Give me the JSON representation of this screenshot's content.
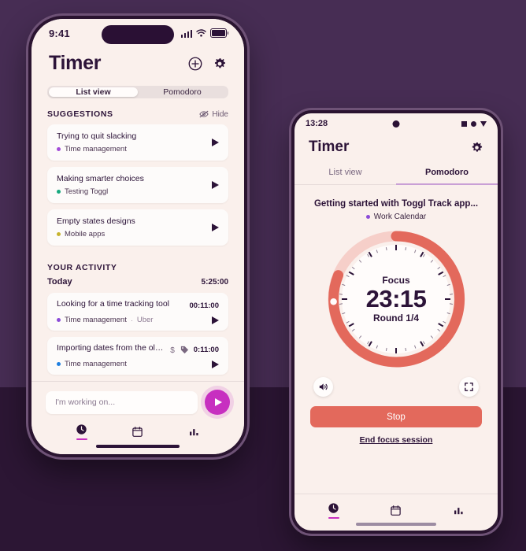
{
  "background": {
    "upper_color": "#472D54",
    "lower_color": "#2C1634"
  },
  "iphone": {
    "status_bar": {
      "time": "9:41",
      "signal_icon": "cellular-signal-icon",
      "wifi_icon": "wifi-icon",
      "battery_icon": "battery-icon"
    },
    "header": {
      "title": "Timer",
      "add_icon": "plus-circle-icon",
      "settings_icon": "gear-icon"
    },
    "segmented_control": {
      "options": [
        "List view",
        "Pomodoro"
      ],
      "selected": "List view"
    },
    "suggestions": {
      "section_title": "SUGGESTIONS",
      "hide_label": "Hide",
      "hide_icon": "eye-off-icon",
      "items": [
        {
          "title": "Trying to quit slacking",
          "project": "Time management",
          "dot_color": "#A34CD8",
          "play_icon": "play-icon"
        },
        {
          "title": "Making smarter choices",
          "project": "Testing Toggl",
          "dot_color": "#17A97F",
          "play_icon": "play-icon"
        },
        {
          "title": "Empty states designs",
          "project": "Mobile apps",
          "dot_color": "#C7B32E",
          "play_icon": "play-icon"
        }
      ]
    },
    "activity": {
      "section_title": "YOUR ACTIVITY",
      "day_label": "Today",
      "day_total": "5:25:00",
      "entries": [
        {
          "title": "Looking for a time tracking tool",
          "project": "Time management",
          "dot_color": "#8B4BD8",
          "client": "Uber",
          "separator": "·",
          "duration": "00:11:00",
          "play_icon": "play-icon",
          "badges": []
        },
        {
          "title": "Importing dates from the old...",
          "project": "Time management",
          "dot_color": "#1E7FE0",
          "client": "",
          "separator": "",
          "duration": "0:11:00",
          "play_icon": "play-icon",
          "badges": [
            "billable-dollar-icon",
            "tag-icon"
          ]
        }
      ]
    },
    "composer": {
      "placeholder": "I'm working on...",
      "start_icon": "play-icon",
      "start_color": "#C72FC0"
    },
    "nav": [
      {
        "icon": "clock-icon",
        "active": true
      },
      {
        "icon": "calendar-icon",
        "active": false
      },
      {
        "icon": "reports-bar-chart-icon",
        "active": false
      }
    ]
  },
  "android": {
    "status_bar": {
      "time": "13:28",
      "camera_icon": "front-camera-dot",
      "icons": [
        "square-icon",
        "circle-icon",
        "triangle-down-icon"
      ]
    },
    "header": {
      "title": "Timer",
      "settings_icon": "gear-icon"
    },
    "tabs": {
      "options": [
        "List view",
        "Pomodoro"
      ],
      "selected": "Pomodoro",
      "indicator_color": "#C9A0D6"
    },
    "pomodoro": {
      "task_title": "Getting started with Toggl Track app...",
      "project": "Work Calendar",
      "project_dot_color": "#8B4BD8",
      "phase_label": "Focus",
      "time_remaining": "23:15",
      "round_label": "Round 1/4",
      "ring_color": "#E3695C",
      "ring_track_color": "#F6CFC9",
      "progress_degrees": 278
    },
    "controls": {
      "sound_icon": "speaker-volume-icon",
      "fullscreen_icon": "fullscreen-expand-icon",
      "stop_label": "Stop",
      "stop_color": "#E3695C",
      "end_session_label": "End focus session"
    },
    "nav": [
      {
        "icon": "clock-icon",
        "active": true
      },
      {
        "icon": "calendar-icon",
        "active": false
      },
      {
        "icon": "reports-bar-chart-icon",
        "active": false
      }
    ]
  }
}
